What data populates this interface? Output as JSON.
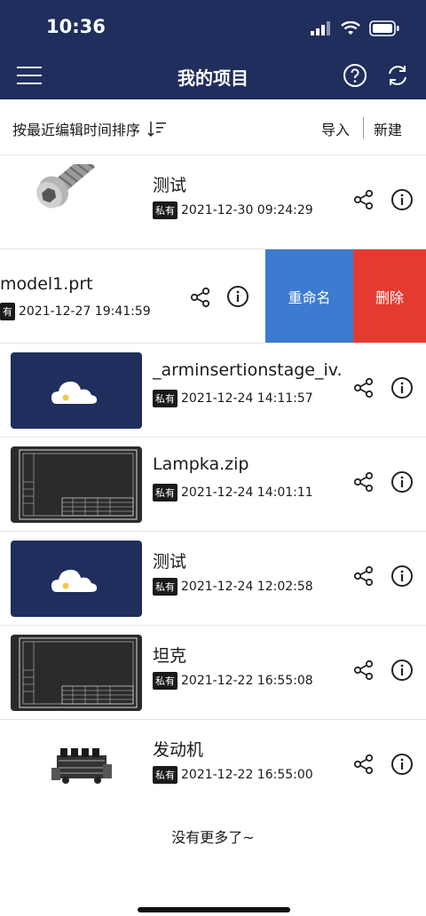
{
  "status_bar": {
    "time": "10:36"
  },
  "nav": {
    "title": "我的项目"
  },
  "toolbar": {
    "sort_label": "按最近编辑时间排序",
    "import_label": "导入",
    "new_label": "新建"
  },
  "badge_label": "私有",
  "items": [
    {
      "name": "测试",
      "badge": "私有",
      "date": "2021-12-30 09:24:29",
      "thumb": "bolt-model"
    },
    {
      "name": "model1.prt",
      "badge": "有",
      "date": "2021-12-27 19:41:59",
      "thumb": "none",
      "swiped": true
    },
    {
      "name": "_arminsertionstage_iv...",
      "badge": "私有",
      "date": "2021-12-24 14:11:57",
      "thumb": "cloud-placeholder"
    },
    {
      "name": "Lampka.zip",
      "badge": "私有",
      "date": "2021-12-24 14:01:11",
      "thumb": "drawing-sheet"
    },
    {
      "name": "测试",
      "badge": "私有",
      "date": "2021-12-24 12:02:58",
      "thumb": "cloud-placeholder"
    },
    {
      "name": "坦克",
      "badge": "私有",
      "date": "2021-12-22 16:55:08",
      "thumb": "drawing-sheet"
    },
    {
      "name": "发动机",
      "badge": "私有",
      "date": "2021-12-22 16:55:00",
      "thumb": "engine-model"
    }
  ],
  "swipe_actions": {
    "rename": "重命名",
    "delete": "删除"
  },
  "footer": {
    "no_more": "没有更多了~"
  },
  "colors": {
    "header_bg": "#1f2e5c",
    "rename_bg": "#3c7bd0",
    "delete_bg": "#e53a2f",
    "cloud_dot": "#f2c94c"
  }
}
